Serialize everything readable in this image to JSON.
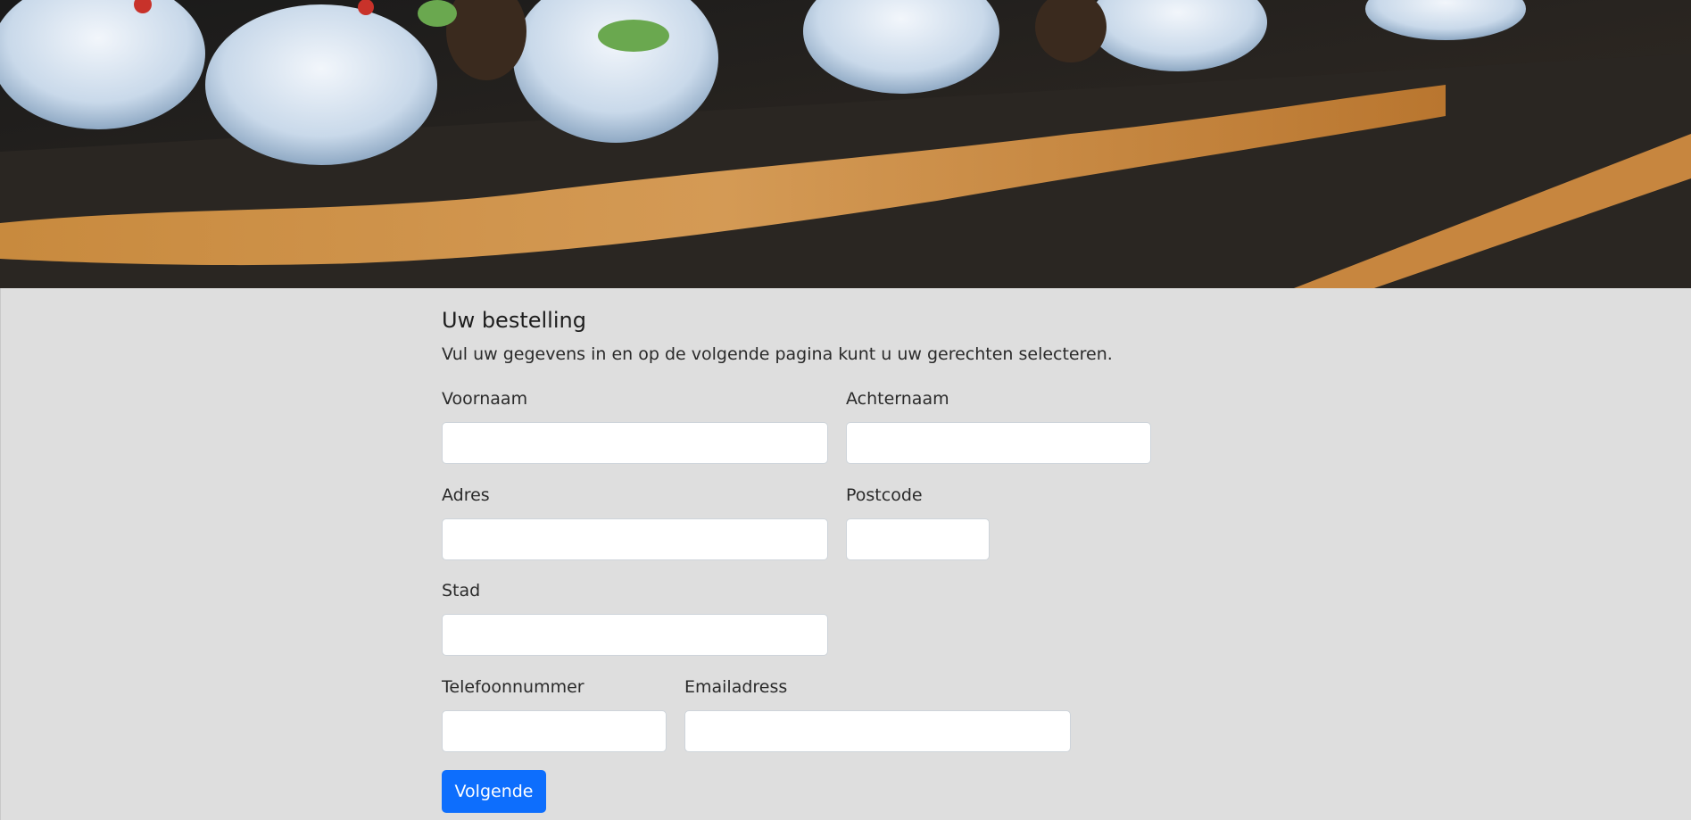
{
  "hero": {
    "image_name": "sushi-banner-image"
  },
  "order": {
    "title": "Uw bestelling",
    "subtitle": "Vul uw gegevens in en op de volgende pagina kunt u uw gerechten selecteren."
  },
  "fields": {
    "voornaam": {
      "label": "Voornaam",
      "value": "",
      "placeholder": ""
    },
    "achternaam": {
      "label": "Achternaam",
      "value": "",
      "placeholder": ""
    },
    "adres": {
      "label": "Adres",
      "value": "",
      "placeholder": ""
    },
    "postcode": {
      "label": "Postcode",
      "value": "",
      "placeholder": ""
    },
    "stad": {
      "label": "Stad",
      "value": "",
      "placeholder": ""
    },
    "telefoonnummer": {
      "label": "Telefoonnummer",
      "value": "",
      "placeholder": ""
    },
    "emailadress": {
      "label": "Emailadress",
      "value": "",
      "placeholder": ""
    }
  },
  "actions": {
    "next_label": "Volgende"
  },
  "colors": {
    "background": "#dedede",
    "primary_button": "#0d6efd",
    "input_border": "#ced4da"
  }
}
